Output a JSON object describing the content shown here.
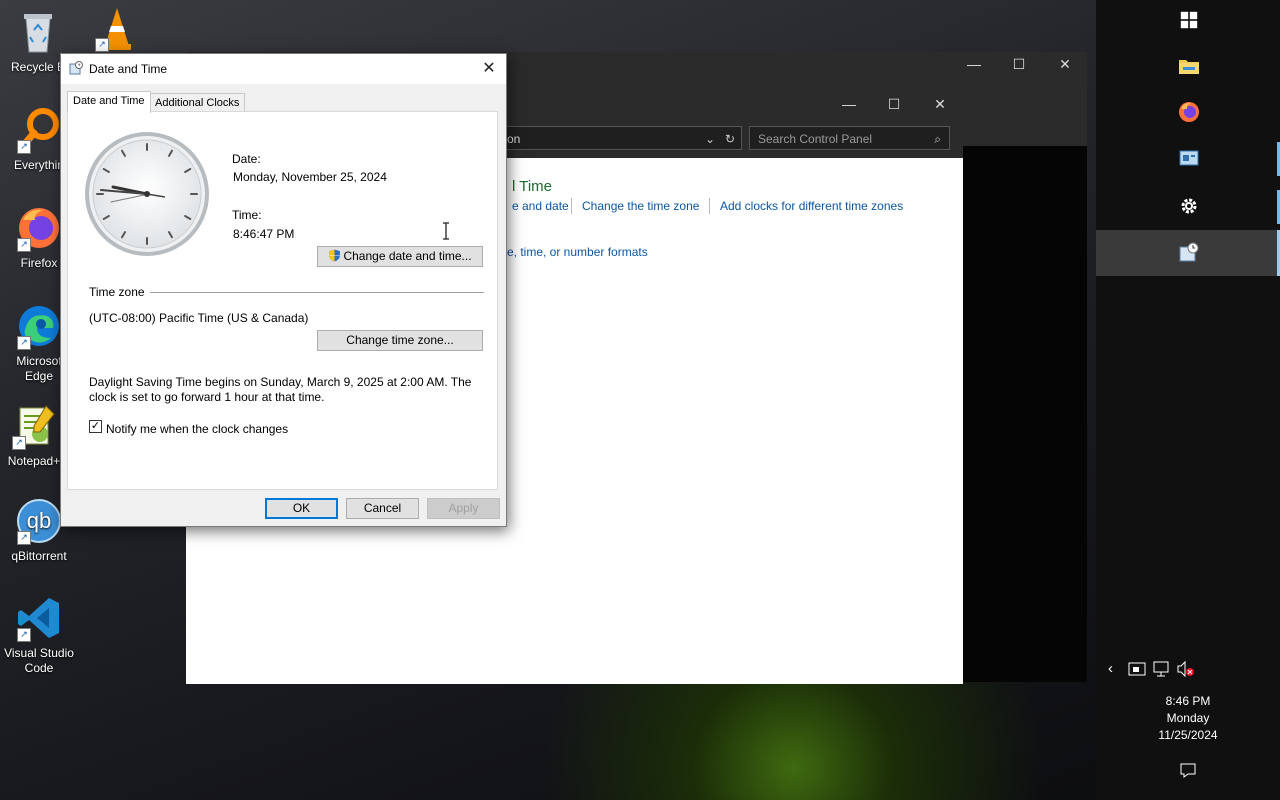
{
  "desktop": {
    "icons": [
      {
        "label": "Recycle B",
        "icon": "recycle-bin-icon"
      },
      {
        "label": "",
        "icon": "vlc-icon"
      },
      {
        "label": "Everythin",
        "icon": "everything-search-icon"
      },
      {
        "label": "Firefox",
        "icon": "firefox-icon"
      },
      {
        "label": "Microsof\nEdge",
        "icon": "edge-icon"
      },
      {
        "label": "Notepad+",
        "icon": "notepad-plus-icon"
      },
      {
        "label": "qBittorrent",
        "icon": "qbittorrent-icon"
      },
      {
        "label": "Visual Studio\nCode",
        "icon": "vscode-icon"
      }
    ]
  },
  "control_panel": {
    "address_text": "on",
    "search_placeholder": "Search Control Panel",
    "heading": "l Time",
    "links": [
      "e and date",
      "Change the time zone",
      "Add clocks for different time zones"
    ],
    "region_link": "e, time, or number formats"
  },
  "dialog": {
    "title": "Date and Time",
    "close_glyph": "✕",
    "tabs": [
      "Date and Time",
      "Additional Clocks"
    ],
    "date_label": "Date:",
    "date_value": "Monday, November 25, 2024",
    "time_label": "Time:",
    "time_value": "8:46:47 PM",
    "change_datetime_button": "Change date and time...",
    "timezone_section": "Time zone",
    "timezone_value": "(UTC-08:00) Pacific Time (US & Canada)",
    "change_timezone_button": "Change time zone...",
    "dst_line1": "Daylight Saving Time begins on Sunday, March 9, 2025 at 2:00 AM. The",
    "dst_line2": "clock is set to go forward 1 hour at that time.",
    "notify_label": "Notify me when the clock changes",
    "notify_checked": true,
    "ok": "OK",
    "cancel": "Cancel",
    "apply": "Apply"
  },
  "taskbar": {
    "icons": [
      "windows-start-icon",
      "file-explorer-icon",
      "firefox-icon",
      "control-panel-icon",
      "settings-gear-icon",
      "date-time-icon"
    ],
    "time": "8:46 PM",
    "day": "Monday",
    "date": "11/25/2024"
  },
  "colors": {
    "accent": "#0078d7",
    "link": "#0b56a6",
    "heading_green": "#1e6b2f"
  }
}
